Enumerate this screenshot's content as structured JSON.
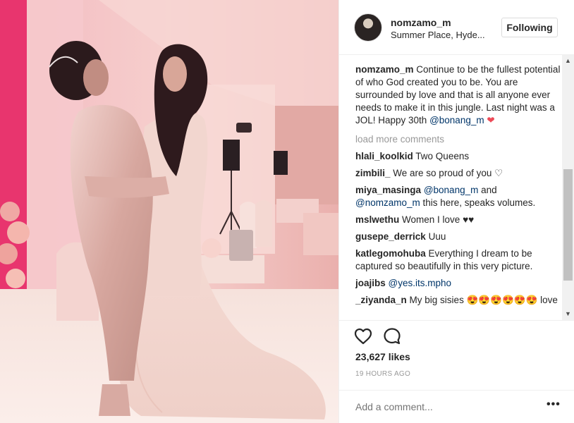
{
  "post": {
    "username": "nomzamo_m",
    "location": "Summer Place, Hyde...",
    "follow_label": "Following"
  },
  "caption": {
    "username": "nomzamo_m",
    "text": "Continue to be the fullest potential of who God created you to be. You are surrounded by love and that is all anyone ever needs to make it in this jungle. Last night was a JOL! Happy 30th",
    "mention": "@bonang_m",
    "emoji": "❤"
  },
  "load_more": "load more comments",
  "comments": [
    {
      "user": "hlali_koolkid",
      "text": "Two Queens"
    },
    {
      "user": "zimbili_",
      "text": "We are so proud of you ♡"
    },
    {
      "user": "miya_masinga",
      "mention": "@bonang_m",
      "text": " and ",
      "mention2": "@nomzamo_m",
      "text2": " this here, speaks volumes."
    },
    {
      "user": "mslwethu",
      "text": "Women I love ♥♥"
    },
    {
      "user": "gusepe_derrick",
      "text": "Uuu"
    },
    {
      "user": "katlegomohuba",
      "text": "Everything I dream to be captured so beautifully in this very picture."
    },
    {
      "user": "joajibs",
      "mention": "@yes.its.mpho"
    },
    {
      "user": "_ziyanda_n",
      "text": "My big sisies 😍😍😍😍😍😍 love"
    }
  ],
  "likes": "23,627 likes",
  "time": "19 HOURS AGO",
  "add_comment_placeholder": "Add a comment...",
  "more_label": "•••",
  "scroll_up": "▲",
  "scroll_down": "▼",
  "icons": [
    "heart-icon",
    "comment-icon",
    "more-options-icon"
  ],
  "colors": {
    "mention": "#003569",
    "heart": "#ed4956",
    "muted": "#999999",
    "border": "#efefef"
  }
}
